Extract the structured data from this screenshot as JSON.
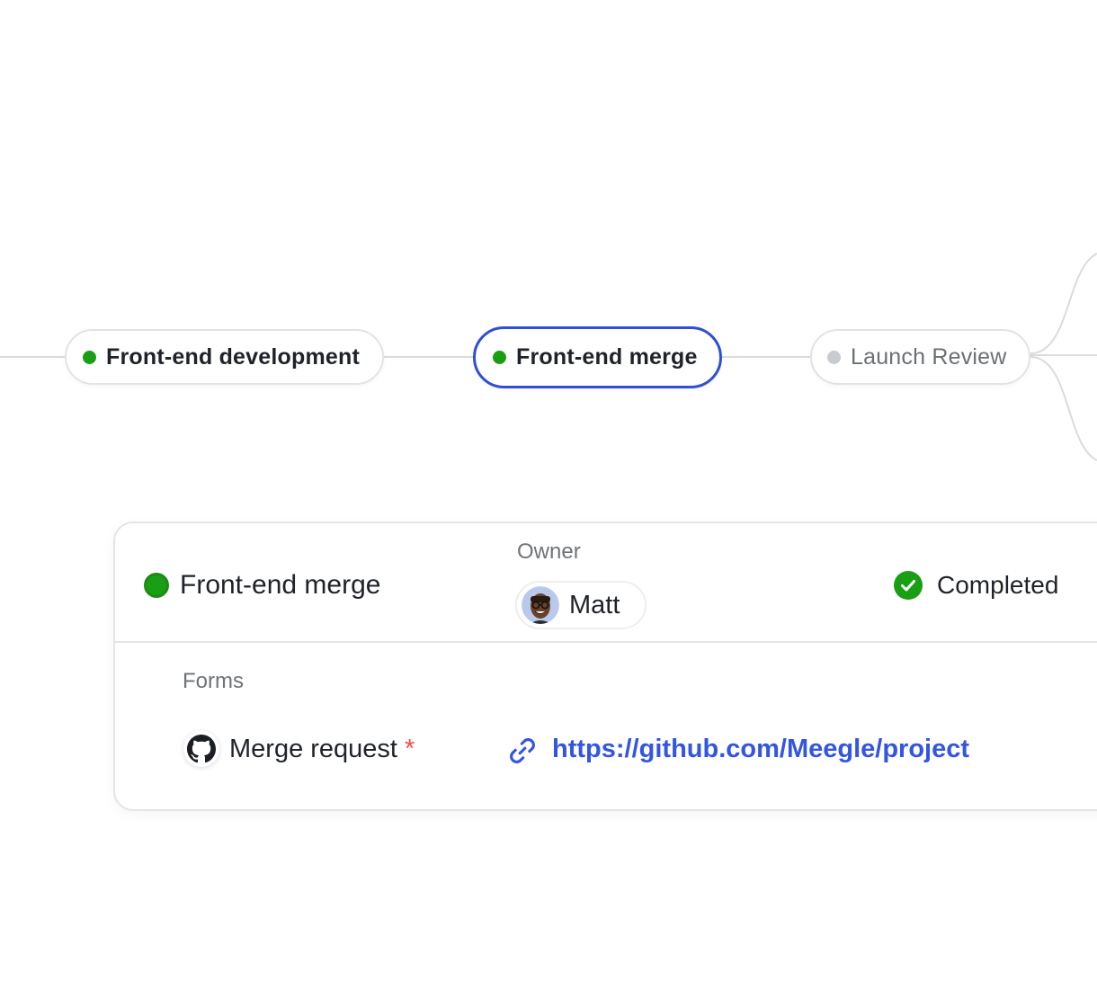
{
  "colors": {
    "status_done": "#1a9e14",
    "status_pending": "#c8cbcf",
    "selected_border": "#2e4fd6",
    "link": "#3355e0",
    "required": "#f54a45",
    "connector": "#d9dbde"
  },
  "flow": {
    "nodes": [
      {
        "label": "Front-end development",
        "status": "done"
      },
      {
        "label": "Front-end merge",
        "status": "done",
        "selected": true
      },
      {
        "label": "Launch Review",
        "status": "pending"
      }
    ]
  },
  "detail": {
    "title": "Front-end merge",
    "owner_label": "Owner",
    "owner_name": "Matt",
    "status_label": "Completed",
    "status_icon": "check-circle-icon",
    "forms_label": "Forms",
    "form_row": {
      "label": "Merge request",
      "required_mark": "*",
      "icon": "github-icon",
      "link_icon": "link-icon",
      "value": "https://github.com/Meegle/project"
    }
  }
}
